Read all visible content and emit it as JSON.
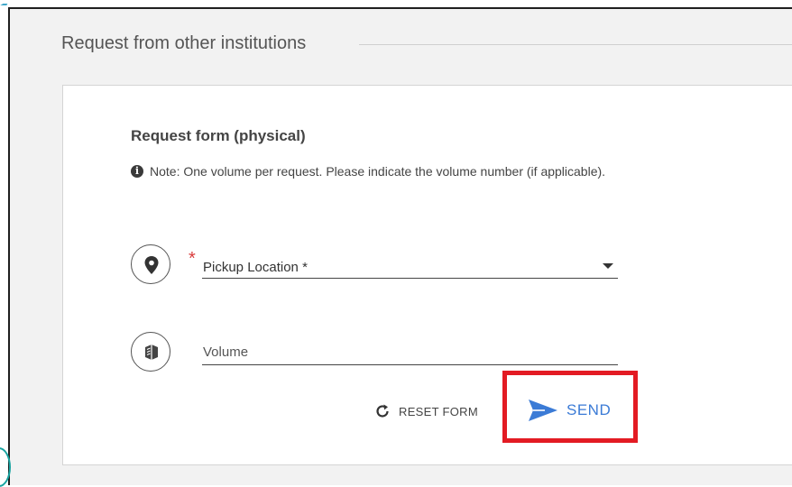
{
  "section": {
    "title": "Request from other institutions"
  },
  "form": {
    "title": "Request form (physical)",
    "note": "Note: One volume per request. Please indicate the volume number (if applicable).",
    "note_icon": "info-icon",
    "pickup": {
      "icon": "location-pin-icon",
      "required_marker": "*",
      "label": "Pickup Location *"
    },
    "volume": {
      "icon": "book-icon",
      "placeholder": "Volume",
      "value": ""
    },
    "actions": {
      "reset_label": "RESET FORM",
      "send_label": "SEND"
    }
  },
  "colors": {
    "accent_blue": "#3b7bd6",
    "highlight_red": "#e31b23",
    "required_red": "#d93b3b"
  }
}
